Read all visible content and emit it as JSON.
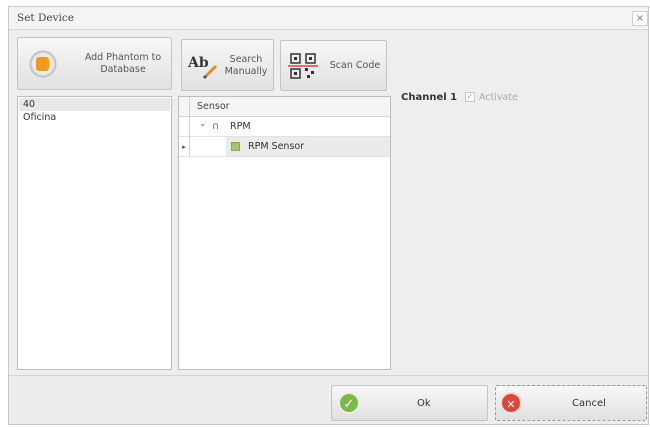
{
  "window": {
    "title": "Set Device",
    "close_glyph": "×"
  },
  "toolbar": {
    "add_phantom_label": "Add Phantom to Database",
    "search_label": "Search Manually",
    "search_icon_text": "Ab",
    "scan_label": "Scan Code"
  },
  "device_list": {
    "items": [
      {
        "label": "40",
        "selected": true
      },
      {
        "label": "Oficina",
        "selected": false
      }
    ]
  },
  "sensor_grid": {
    "header": "Sensor",
    "rows": [
      {
        "label": "RPM",
        "expander": "⌄",
        "node_glyph": "∩"
      },
      {
        "label": "RPM Sensor",
        "indicator": "▸"
      }
    ]
  },
  "channel": {
    "label": "Channel 1",
    "activate_label": "Activate",
    "activate_checked": true,
    "check_glyph": "✓"
  },
  "footer": {
    "ok_label": "Ok",
    "ok_glyph": "✓",
    "cancel_label": "Cancel",
    "cancel_glyph": "✕"
  },
  "colors": {
    "ok_icon": "#7db84a",
    "cancel_icon": "#d9473d",
    "phantom_icon": "#f29a1f",
    "sensor_node": "#a8c46a"
  }
}
